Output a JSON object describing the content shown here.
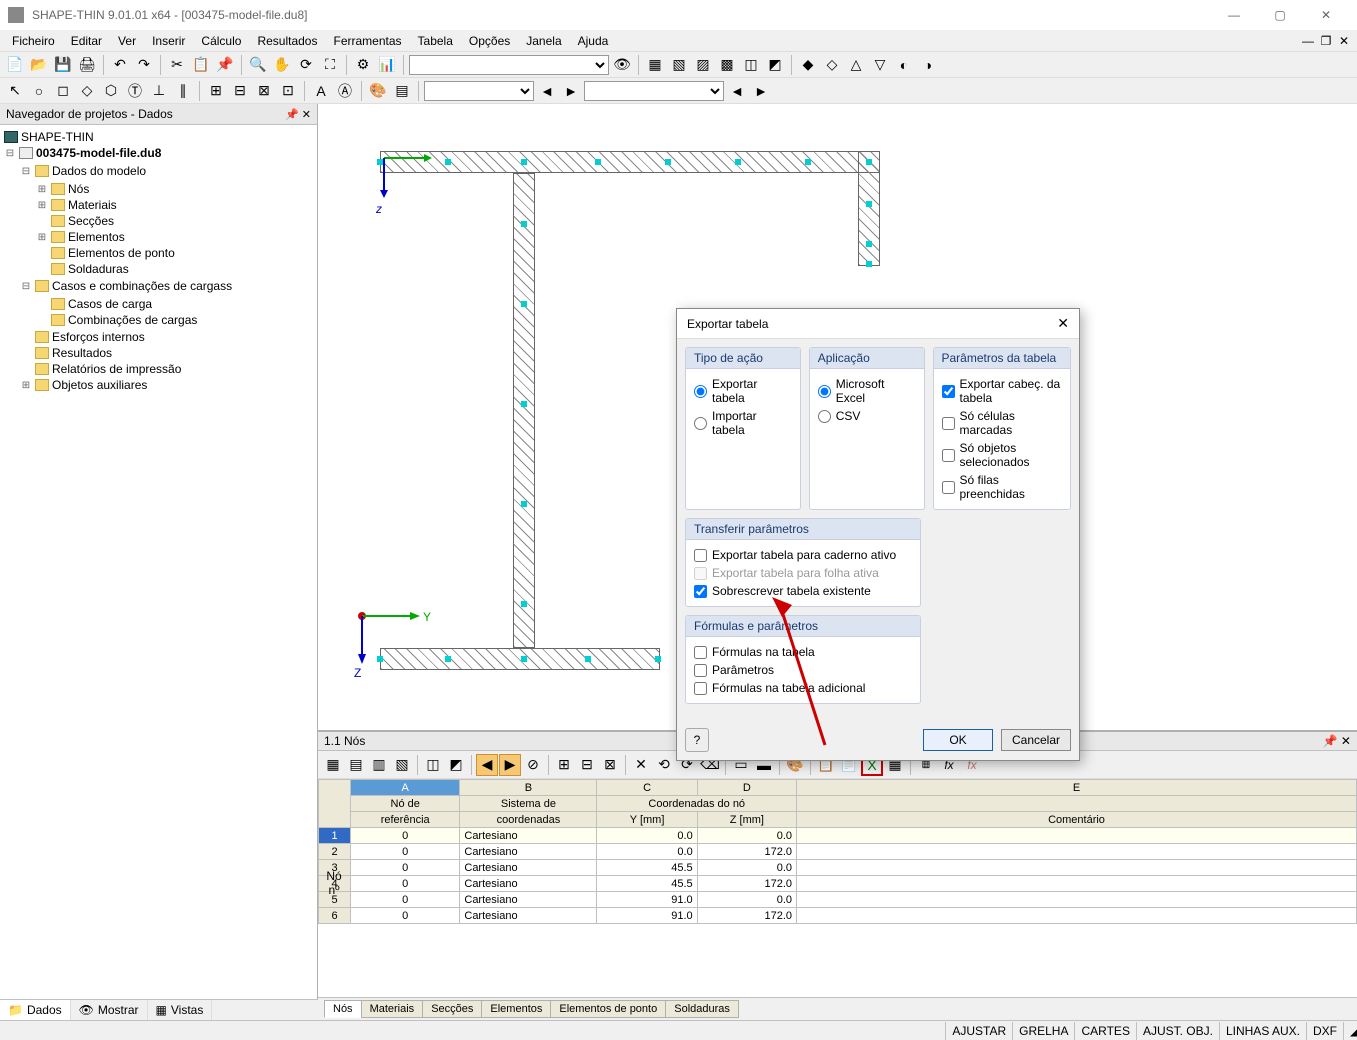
{
  "titlebar": {
    "text": "SHAPE-THIN 9.01.01 x64 - [003475-model-file.du8]"
  },
  "menus": [
    "Ficheiro",
    "Editar",
    "Ver",
    "Inserir",
    "Cálculo",
    "Resultados",
    "Ferramentas",
    "Tabela",
    "Opções",
    "Janela",
    "Ajuda"
  ],
  "navigator": {
    "title": "Navegador de projetos - Dados",
    "root": "SHAPE-THIN",
    "file": "003475-model-file.du8",
    "groups": {
      "dados": "Dados do modelo",
      "dados_children": [
        "Nós",
        "Materiais",
        "Secções",
        "Elementos",
        "Elementos de ponto",
        "Soldaduras"
      ],
      "casos": "Casos e combinações de cargass",
      "casos_children": [
        "Casos de carga",
        "Combinações de cargas"
      ],
      "esforcos": "Esforços internos",
      "resultados": "Resultados",
      "relatorios": "Relatórios de impressão",
      "objetos": "Objetos auxiliares"
    },
    "tabs": [
      "Dados",
      "Mostrar",
      "Vistas"
    ]
  },
  "tablepanel": {
    "title": "1.1 Nós",
    "columns_letters": [
      "A",
      "B",
      "C",
      "D",
      "E"
    ],
    "header_row1": {
      "no": "Nó",
      "ref": "Nó de",
      "sys": "Sistema de",
      "coord": "Coordenadas do nó",
      "com": ""
    },
    "header_row2": {
      "no": "nº",
      "ref": "referência",
      "sys": "coordenadas",
      "y": "Y [mm]",
      "z": "Z [mm]",
      "com": "Comentário"
    },
    "rows": [
      {
        "n": "1",
        "ref": "0",
        "sys": "Cartesiano",
        "y": "0.0",
        "z": "0.0"
      },
      {
        "n": "2",
        "ref": "0",
        "sys": "Cartesiano",
        "y": "0.0",
        "z": "172.0"
      },
      {
        "n": "3",
        "ref": "0",
        "sys": "Cartesiano",
        "y": "45.5",
        "z": "0.0"
      },
      {
        "n": "4",
        "ref": "0",
        "sys": "Cartesiano",
        "y": "45.5",
        "z": "172.0"
      },
      {
        "n": "5",
        "ref": "0",
        "sys": "Cartesiano",
        "y": "91.0",
        "z": "0.0"
      },
      {
        "n": "6",
        "ref": "0",
        "sys": "Cartesiano",
        "y": "91.0",
        "z": "172.0"
      }
    ],
    "tabs": [
      "Nós",
      "Materiais",
      "Secções",
      "Elementos",
      "Elementos de ponto",
      "Soldaduras"
    ]
  },
  "dialog": {
    "title": "Exportar tabela",
    "tipo_head": "Tipo de ação",
    "tipo_exportar": "Exportar tabela",
    "tipo_importar": "Importar tabela",
    "app_head": "Aplicação",
    "app_excel": "Microsoft Excel",
    "app_csv": "CSV",
    "param_head": "Parâmetros da tabela",
    "param_cabec": "Exportar cabeç. da tabela",
    "param_celulas": "Só células marcadas",
    "param_objetos": "Só objetos selecionados",
    "param_filas": "Só filas preenchidas",
    "transfer_head": "Transferir parâmetros",
    "transfer_caderno": "Exportar tabela para caderno ativo",
    "transfer_folha": "Exportar tabela para folha ativa",
    "transfer_sobrescrever": "Sobrescrever tabela existente",
    "formulas_head": "Fórmulas e parâmetros",
    "formulas_tabela": "Fórmulas na tabela",
    "formulas_param": "Parâmetros",
    "formulas_adicional": "Fórmulas na tabela adicional",
    "ok": "OK",
    "cancel": "Cancelar"
  },
  "statusbar": [
    "AJUSTAR",
    "GRELHA",
    "CARTES",
    "AJUST. OBJ.",
    "LINHAS AUX.",
    "DXF"
  ],
  "axis": {
    "y": "Y",
    "z": "Z",
    "z2": "z"
  }
}
